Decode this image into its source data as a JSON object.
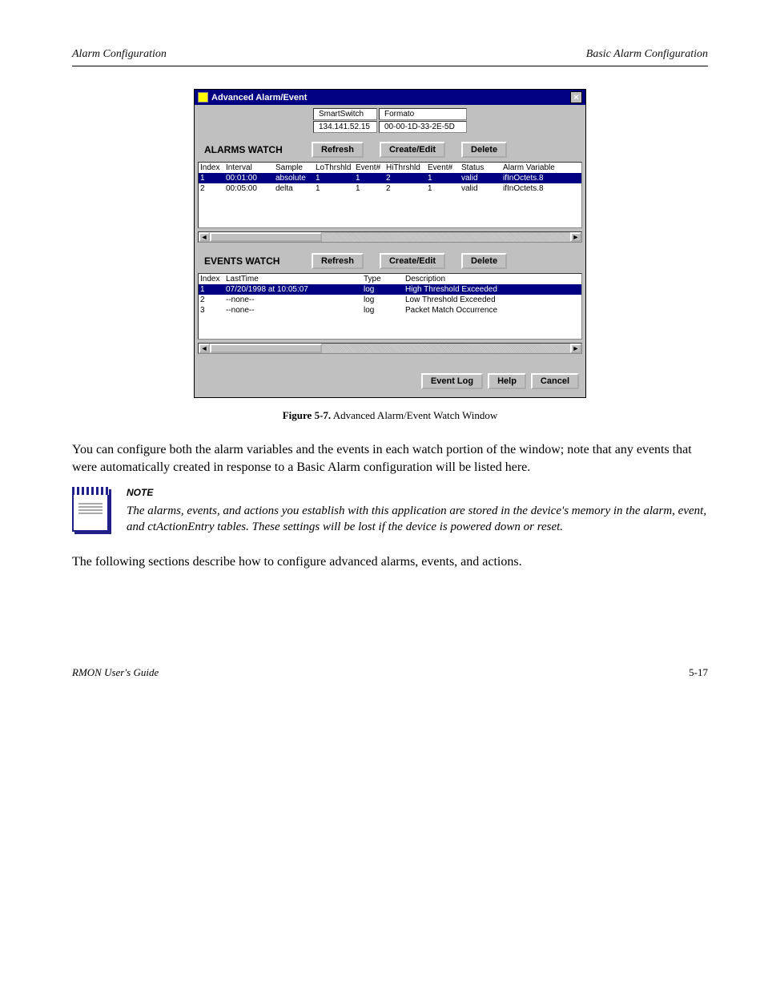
{
  "header": {
    "left": "Alarm Configuration",
    "right": "Basic Alarm Configuration"
  },
  "window": {
    "title": "Advanced Alarm/Event",
    "device_name": "SmartSwitch",
    "ip": "134.141.52.15",
    "sys_label": "Formato",
    "mac": "00-00-1D-33-2E-5D"
  },
  "alarms": {
    "title": "ALARMS WATCH",
    "buttons": {
      "refresh": "Refresh",
      "create_edit": "Create/Edit",
      "delete": "Delete"
    },
    "columns": [
      "Index",
      "Interval",
      "Sample",
      "LoThrshld",
      "Event#",
      "HiThrshld",
      "Event#",
      "Status",
      "Alarm Variable"
    ],
    "rows": [
      {
        "selected": true,
        "cells": [
          "1",
          "00:01:00",
          "absolute",
          "1",
          "1",
          "2",
          "1",
          "valid",
          "ifInOctets.8"
        ]
      },
      {
        "selected": false,
        "cells": [
          "2",
          "00:05:00",
          "delta",
          "1",
          "1",
          "2",
          "1",
          "valid",
          "ifInOctets.8"
        ]
      }
    ]
  },
  "events": {
    "title": "EVENTS WATCH",
    "buttons": {
      "refresh": "Refresh",
      "create_edit": "Create/Edit",
      "delete": "Delete"
    },
    "columns": [
      "Index",
      "LastTime",
      "Type",
      "Description"
    ],
    "rows": [
      {
        "selected": true,
        "cells": [
          "1",
          "07/20/1998 at 10:05:07",
          "log",
          "High Threshold Exceeded"
        ]
      },
      {
        "selected": false,
        "cells": [
          "2",
          "--none--",
          "log",
          "Low Threshold Exceeded"
        ]
      },
      {
        "selected": false,
        "cells": [
          "3",
          "--none--",
          "log",
          "Packet Match Occurrence"
        ]
      }
    ]
  },
  "bottom_buttons": {
    "event_log": "Event Log",
    "help": "Help",
    "cancel": "Cancel"
  },
  "figure_caption": {
    "label": "Figure 5-7.",
    "text": "Advanced Alarm/Event Watch Window"
  },
  "para1": "You can configure both the alarm variables and the events in each watch portion of the window; note that any events that were automatically created in response to a Basic Alarm configuration will be listed here.",
  "note": {
    "label": "NOTE",
    "text": "The alarms, events, and actions you establish with this application are stored in the device's memory in the alarm, event, and ctActionEntry tables. These settings will be lost if the device is powered down or reset."
  },
  "para2": "The following sections describe how to configure advanced alarms, events, and actions.",
  "footer": {
    "label": "RMON User's Guide",
    "page": "5-17"
  }
}
